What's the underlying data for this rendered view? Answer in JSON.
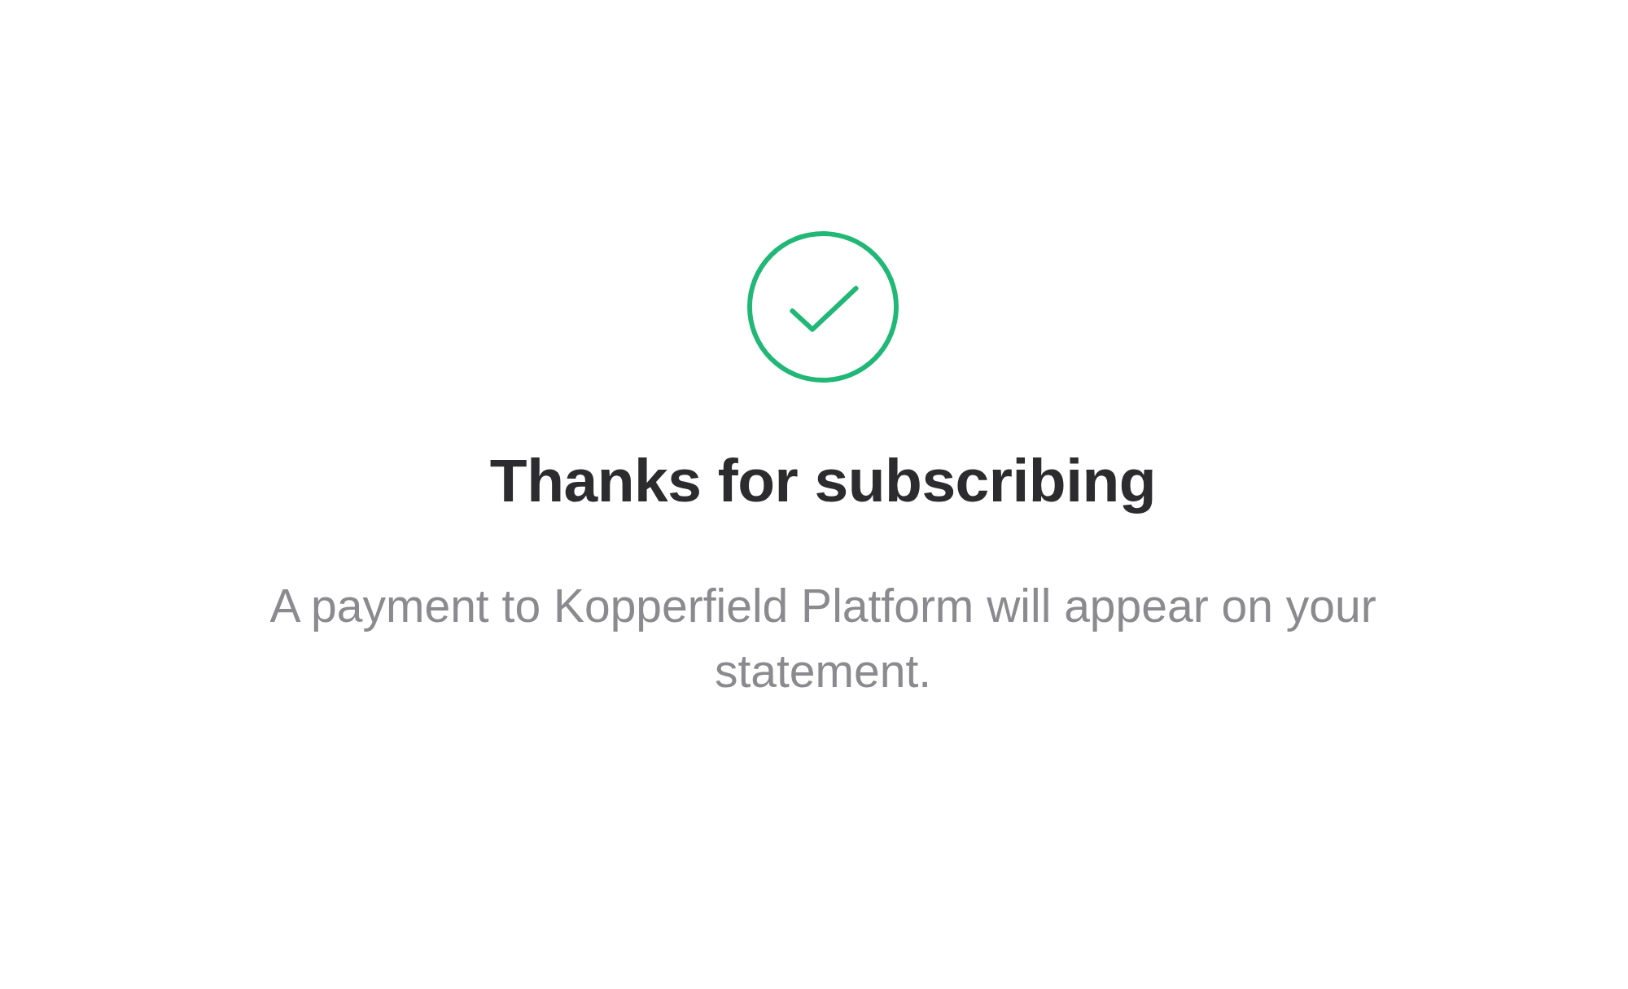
{
  "confirmation": {
    "title": "Thanks for subscribing",
    "message": "A payment to Kopperfield Platform will appear on your statement."
  }
}
